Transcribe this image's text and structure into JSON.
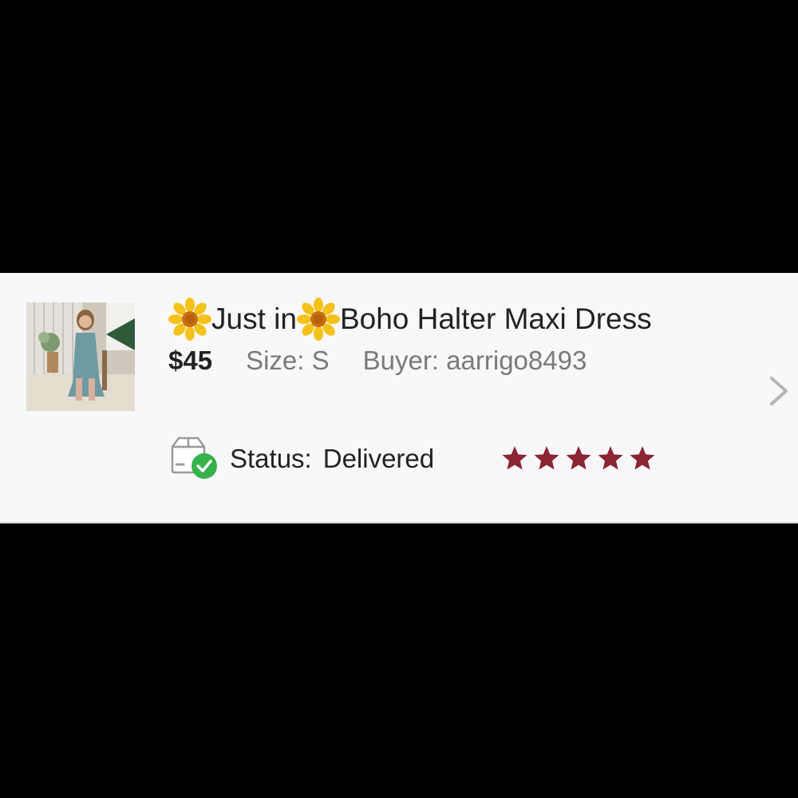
{
  "listing": {
    "title_prefix": "Just in",
    "title_main": "Boho Halter Maxi Dress",
    "price": "$45",
    "size_label": "Size:",
    "size_value": "S",
    "buyer_label": "Buyer:",
    "buyer_value": "aarrigo8493",
    "status_label": "Status:",
    "status_value": "Delivered",
    "rating": 5,
    "rating_max": 5
  },
  "icons": {
    "title_emoji": "sunflower-icon",
    "status": "package-delivered-icon",
    "chevron": "chevron-right-icon",
    "rating": "star-icon"
  },
  "colors": {
    "star": "#8b2436",
    "check": "#36b24a",
    "price": "#222222",
    "muted": "#7a7a7a"
  }
}
